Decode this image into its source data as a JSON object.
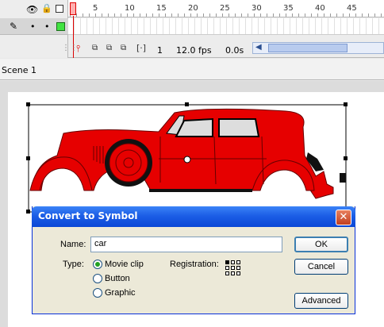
{
  "timeline": {
    "ruler_numbers": [
      "1",
      "5",
      "10",
      "15",
      "20",
      "25",
      "30",
      "35",
      "40",
      "45"
    ],
    "current_frame": "1",
    "frame_rate": "12.0 fps",
    "elapsed_time": "0.0s"
  },
  "scene": {
    "label": "Scene 1"
  },
  "dialog": {
    "title": "Convert to Symbol",
    "close_glyph": "✕",
    "name_label": "Name:",
    "name_value": "car",
    "type_label": "Type:",
    "type_options": [
      {
        "label": "Movie clip",
        "selected": true
      },
      {
        "label": "Button",
        "selected": false
      },
      {
        "label": "Graphic",
        "selected": false
      }
    ],
    "registration_label": "Registration:",
    "ok_label": "OK",
    "cancel_label": "Cancel",
    "advanced_label": "Advanced"
  },
  "colors": {
    "car_body": "#e60000",
    "dialog_title_bar": "#0a47d6",
    "playhead": "#dd0000"
  },
  "icons": [
    "eye-icon",
    "lock-icon",
    "outline-icon",
    "pencil-icon",
    "playhead-icon",
    "onion-skin-icon",
    "center-frame-icon",
    "registration-grid-icon",
    "close-icon"
  ]
}
